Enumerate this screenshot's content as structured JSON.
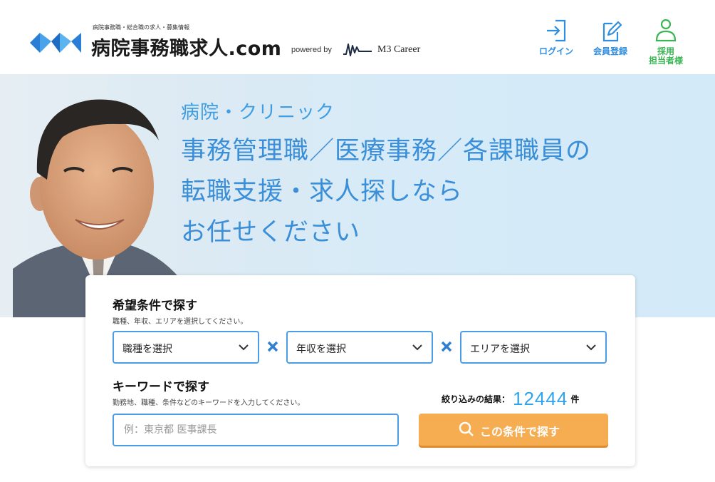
{
  "header": {
    "tagline": "病院事務職・総合職の求人・募集情報",
    "site_name": "病院事務職求人.com",
    "powered_by": "powered by",
    "partner": "M3 Career",
    "buttons": {
      "login": "ログイン",
      "register": "会員登録",
      "employer_line1": "採用",
      "employer_line2": "担当者様"
    }
  },
  "hero": {
    "subtitle": "病院・クリニック",
    "line1": "事務管理職／医療事務／各課職員の",
    "line2": "転職支援・求人探しなら",
    "line3": "お任せください"
  },
  "search": {
    "conditions_title": "希望条件で探す",
    "conditions_desc": "職種、年収、エリアを選択してください。",
    "select_job": "職種を選択",
    "select_salary": "年収を選択",
    "select_area": "エリアを選択",
    "keyword_title": "キーワードで探す",
    "keyword_desc": "勤務地、職種、条件などのキーワードを入力してください。",
    "keyword_placeholder": "例：東京都 医事課長",
    "result_label": "絞り込みの結果：",
    "result_count": "12444",
    "result_unit": "件",
    "search_button": "この条件で探す"
  },
  "colors": {
    "accent_blue": "#4a9de6",
    "search_orange": "#f6ad52",
    "employer_green": "#3bb554"
  }
}
